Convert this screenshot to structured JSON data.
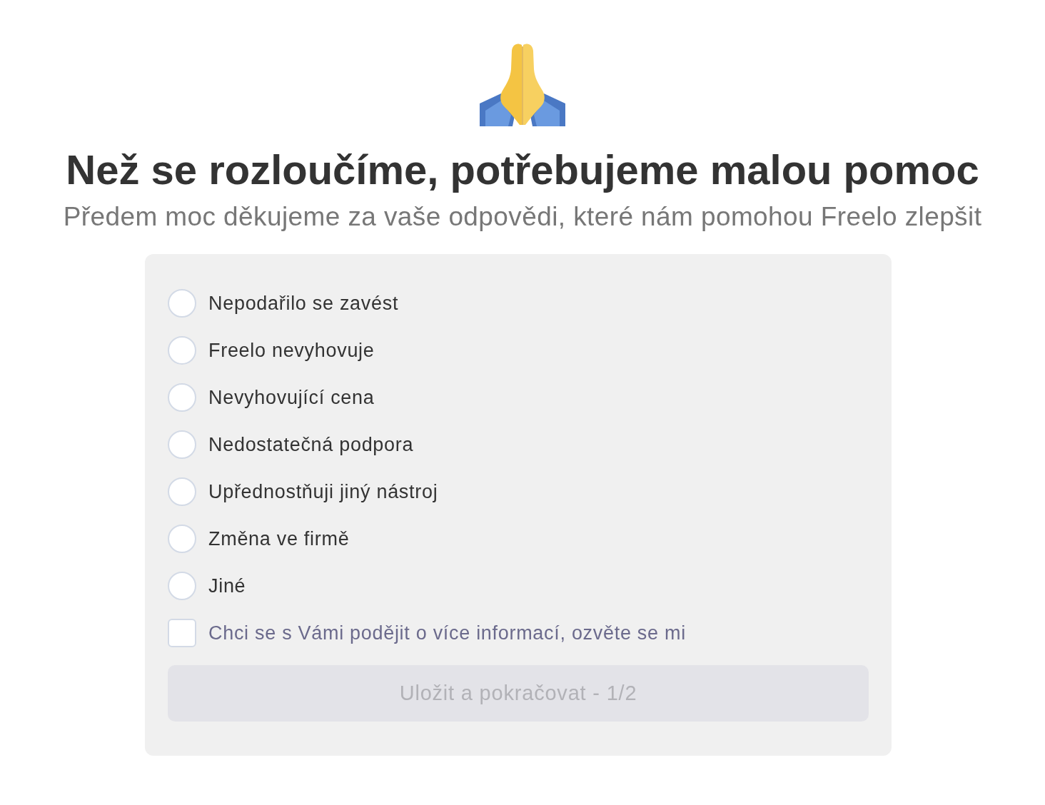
{
  "heading": "Než se rozloučíme, potřebujeme malou pomoc",
  "subtitle": "Předem moc děkujeme za vaše odpovědi, které nám pomohou Freelo zlepšit",
  "reasons": [
    {
      "label": "Nepodařilo se zavést",
      "selected": false
    },
    {
      "label": "Freelo nevyhovuje",
      "selected": false
    },
    {
      "label": "Nevyhovující cena",
      "selected": false
    },
    {
      "label": "Nedostatečná podpora",
      "selected": false
    },
    {
      "label": "Upřednostňuji jiný nástroj",
      "selected": false
    },
    {
      "label": "Změna ve firmě",
      "selected": false
    },
    {
      "label": "Jiné",
      "selected": false
    }
  ],
  "contact_checkbox": {
    "label": "Chci se s Vámi podějit o více informací, ozvěte se mi",
    "checked": false
  },
  "submit_button": {
    "label": "Uložit a pokračovat - 1/2",
    "disabled": true
  }
}
